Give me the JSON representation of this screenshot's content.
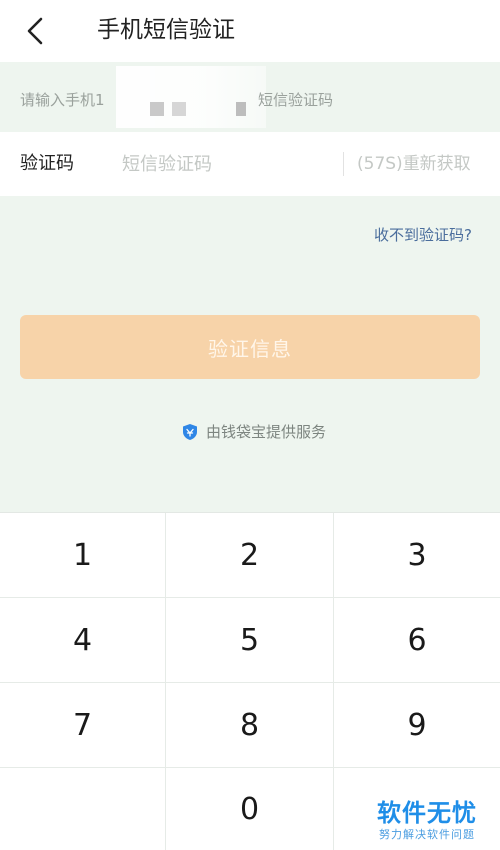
{
  "header": {
    "title": "手机短信验证",
    "back_icon": "chevron-left-icon"
  },
  "hint": {
    "prefix": "请输入手机1",
    "suffix": "短信验证码"
  },
  "code_field": {
    "label": "验证码",
    "placeholder": "短信验证码",
    "value": "",
    "resend_label": "(57S)重新获取"
  },
  "no_code_link": "收不到验证码?",
  "verify_button": "验证信息",
  "provider": {
    "icon": "shield-icon",
    "text": "由钱袋宝提供服务",
    "icon_color": "#2f86e6"
  },
  "keypad": {
    "keys": [
      "1",
      "2",
      "3",
      "4",
      "5",
      "6",
      "7",
      "8",
      "9",
      "",
      "0",
      ""
    ]
  },
  "watermark": {
    "title": "软件无忧",
    "subtitle": "努力解决软件问题"
  },
  "colors": {
    "background": "#eef5ef",
    "button_disabled": "#f7d3a9",
    "link": "#4a6d9c"
  }
}
